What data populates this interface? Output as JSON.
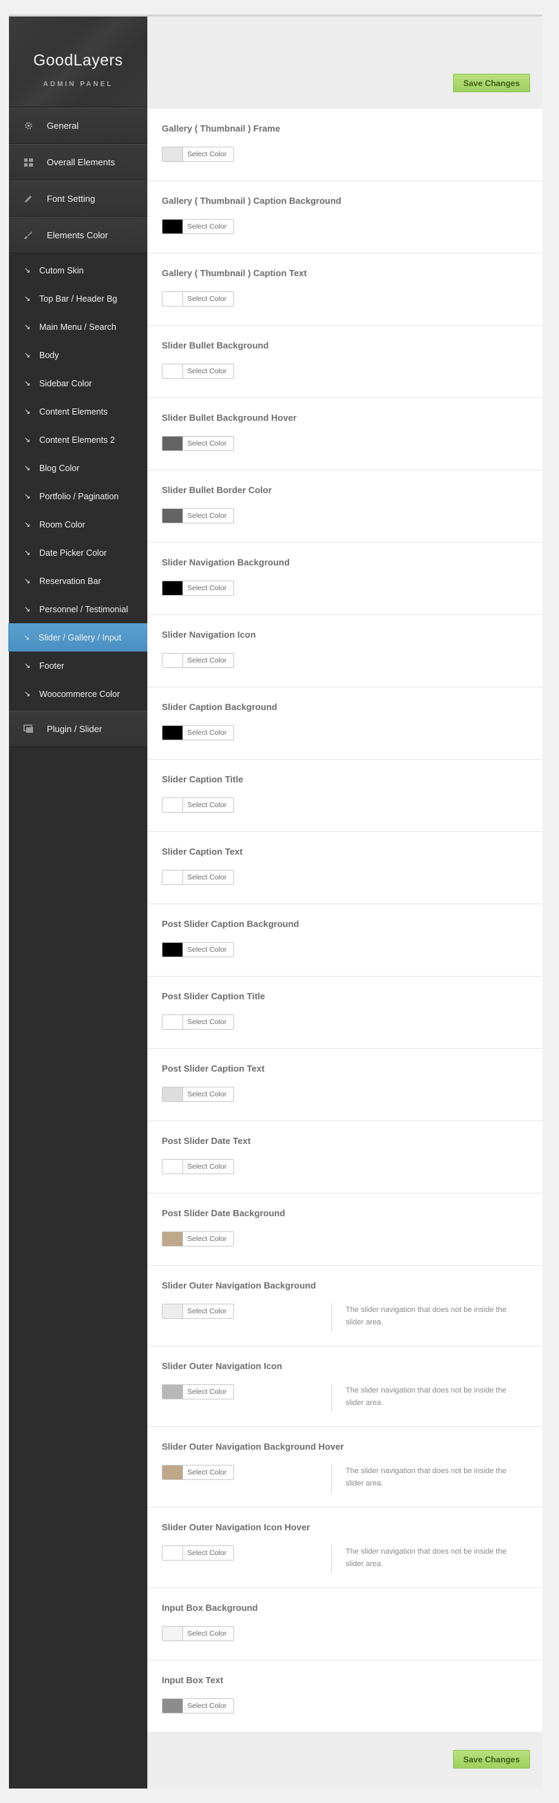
{
  "sidebar": {
    "logo_title": "GoodLayers",
    "logo_subtitle": "ADMIN PANEL",
    "main_items_top": [
      {
        "label": "General",
        "icon": "gear-icon"
      },
      {
        "label": "Overall Elements",
        "icon": "grid-icon"
      },
      {
        "label": "Font Setting",
        "icon": "pencil-icon"
      },
      {
        "label": "Elements Color",
        "icon": "brush-icon"
      }
    ],
    "sub_items": [
      {
        "label": "Cutom Skin"
      },
      {
        "label": "Top Bar / Header Bg"
      },
      {
        "label": "Main Menu / Search"
      },
      {
        "label": "Body"
      },
      {
        "label": "Sidebar Color"
      },
      {
        "label": "Content Elements"
      },
      {
        "label": "Content Elements 2"
      },
      {
        "label": "Blog Color"
      },
      {
        "label": "Portfolio / Pagination"
      },
      {
        "label": "Room Color"
      },
      {
        "label": "Date Picker Color"
      },
      {
        "label": "Reservation Bar"
      },
      {
        "label": "Personnel / Testimonial"
      },
      {
        "label": "Slider / Gallery / Input",
        "active": true
      },
      {
        "label": "Footer"
      },
      {
        "label": "Woocommerce Color"
      }
    ],
    "main_items_bottom": [
      {
        "label": "Plugin / Slider",
        "icon": "monitor-icon"
      }
    ]
  },
  "toolbar": {
    "save_label": "Save Changes"
  },
  "picker_label": "Select Color",
  "options": [
    {
      "label": "Gallery ( Thumbnail ) Frame",
      "color": "#e5e5e5"
    },
    {
      "label": "Gallery ( Thumbnail ) Caption Background",
      "color": "#000000"
    },
    {
      "label": "Gallery ( Thumbnail ) Caption Text",
      "color": "#ffffff"
    },
    {
      "label": "Slider Bullet Background",
      "color": "#ffffff"
    },
    {
      "label": "Slider Bullet Background Hover",
      "color": "#646464"
    },
    {
      "label": "Slider Bullet Border Color",
      "color": "#646464"
    },
    {
      "label": "Slider Navigation Background",
      "color": "#000000"
    },
    {
      "label": "Slider Navigation Icon",
      "color": "#ffffff"
    },
    {
      "label": "Slider Caption Background",
      "color": "#000000"
    },
    {
      "label": "Slider Caption Title",
      "color": "#ffffff"
    },
    {
      "label": "Slider Caption Text",
      "color": "#ffffff"
    },
    {
      "label": "Post Slider Caption Background",
      "color": "#000000"
    },
    {
      "label": "Post Slider Caption Title",
      "color": "#ffffff"
    },
    {
      "label": "Post Slider Caption Text",
      "color": "#dddddd"
    },
    {
      "label": "Post Slider Date Text",
      "color": "#ffffff"
    },
    {
      "label": "Post Slider Date Background",
      "color": "#bfa78a"
    },
    {
      "label": "Slider Outer Navigation Background",
      "color": "#ececec",
      "desc": "The slider navigation that does not be inside the slider area."
    },
    {
      "label": "Slider Outer Navigation Icon",
      "color": "#b8b8b8",
      "desc": "The slider navigation that does not be inside the slider area."
    },
    {
      "label": "Slider Outer Navigation Background Hover",
      "color": "#bfa78a",
      "desc": "The slider navigation that does not be inside the slider area."
    },
    {
      "label": "Slider Outer Navigation Icon Hover",
      "color": "#ffffff",
      "desc": "The slider navigation that does not be inside the slider area."
    },
    {
      "label": "Input Box Background",
      "color": "#f3f3f3"
    },
    {
      "label": "Input Box Text",
      "color": "#8c8c8c"
    }
  ]
}
